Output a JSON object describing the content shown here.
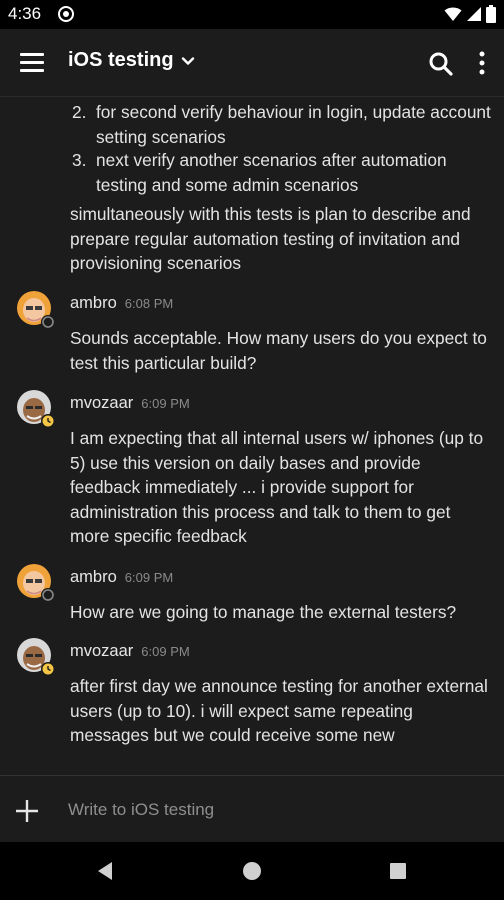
{
  "status_bar": {
    "time": "4:36"
  },
  "app_bar": {
    "channel_title": "iOS testing"
  },
  "messages": {
    "continuation": {
      "items": [
        {
          "number": "2.",
          "text": "for second verify behaviour in login, update account setting scenarios"
        },
        {
          "number": "3.",
          "text": "next verify another scenarios after automation testing and some admin scenarios"
        }
      ],
      "paragraph": "simultaneously with this tests is plan to describe and prepare regular automation testing of invitation and provisioning scenarios"
    },
    "list": [
      {
        "author": "ambro",
        "time": "6:08 PM",
        "text": "Sounds acceptable. How many users do you expect to test this particular build?"
      },
      {
        "author": "mvozaar",
        "time": "6:09 PM",
        "text": "I am expecting that all internal users w/ iphones (up to 5) use this version on daily bases and provide feedback immediately ... i provide support for administration this process and talk to them to get more specific feedback"
      },
      {
        "author": "ambro",
        "time": "6:09 PM",
        "text": "How are we going to manage the external testers?"
      },
      {
        "author": "mvozaar",
        "time": "6:09 PM",
        "text": "after first day we announce testing for another external users (up to 10). i will expect same repeating messages but we could receive some new"
      }
    ]
  },
  "composer": {
    "placeholder": "Write to iOS testing"
  },
  "icons": {
    "menu": "hamburger-menu-icon",
    "dropdown": "chevron-down-icon",
    "search": "search-icon",
    "more": "more-vert-icon",
    "add": "plus-icon",
    "status_offline": "offline-status-icon",
    "status_away": "away-clock-status-icon"
  },
  "colors": {
    "background": "#1c1c1c",
    "text": "#e3e3e3",
    "muted": "#8a8a8a",
    "away": "#f5c544"
  }
}
